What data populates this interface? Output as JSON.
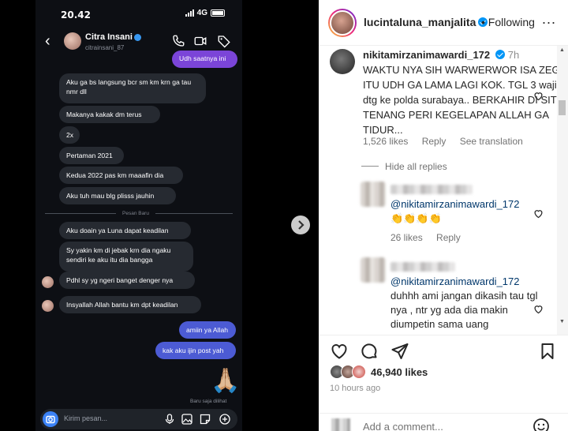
{
  "phone": {
    "time": "20.42",
    "network": "4G",
    "contact_name": "Citra Insani",
    "contact_handle": "citrainsani_87",
    "messages": [
      "Udh saatnya ini",
      "Aku ga bs langsung bcr sm km krn ga tau nmr dll",
      "Makanya kakak dm terus",
      "2x",
      "Pertaman 2021",
      "Kedua 2022 pas km maaafin dia",
      "Aku tuh mau blg plisss jauhin",
      "Aku doain ya Luna dapat keadilan",
      "Sy yakin km di jebak krn dia ngaku sendiri ke aku itu dia bangga",
      "Pdhl sy yg ngeri banget denger nya",
      "Insyallah Allah bantu km dpt keadilan",
      "amiin ya Allah",
      "kak aku ijin post yah"
    ],
    "divider_label": "Pesan Baru",
    "seen_label": "Baru saja dilihat",
    "pray_emoji": "🙏🏼",
    "compose_placeholder": "Kirim pesan..."
  },
  "post": {
    "username": "lucintaluna_manjalita",
    "follow_label": "Following",
    "more_label": "...",
    "comment": {
      "username": "nikitamirzanimawardi_172",
      "time": "7h",
      "text": "WAKTU NYA SIH WARWERWOR ISA ZEGA ITU UDH GA LAMA LAGI KOK. TGL 3 wajib dtg ke polda surabaya.. BERKAHIR DI SITU. TENANG PERI KEGELAPAN ALLAH GA TIDUR...",
      "likes": "1,526 likes",
      "reply": "Reply",
      "translate": "See translation",
      "hide_replies": "Hide all replies"
    },
    "replies": [
      {
        "mention": "@nikitamirzanimawardi_172",
        "text": "👏👏👏👏",
        "likes": "26 likes",
        "reply": "Reply"
      },
      {
        "mention": "@nikitamirzanimawardi_172",
        "text": "duhhh ami jangan dikasih tau tgl nya , ntr yg ada dia makin diumpetin sama uang"
      }
    ],
    "likes_total": "46,940 likes",
    "posted": "10 hours ago",
    "add_comment_placeholder": "Add a comment..."
  },
  "colors": {
    "accent_blue": "#0095f6",
    "outgoing_bubble": "#4c5bd4",
    "incoming_bubble": "#262a31"
  }
}
